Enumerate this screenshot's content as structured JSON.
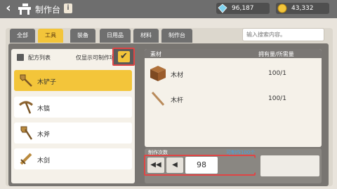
{
  "header": {
    "title": "制作台",
    "info_label": "i",
    "diamonds": "96,187",
    "coins": "43,332",
    "back_label": "‹"
  },
  "tabs": [
    {
      "label": "全部",
      "active": false
    },
    {
      "label": "工具",
      "active": true
    },
    {
      "label": "装备",
      "active": false
    },
    {
      "label": "日用品",
      "active": false
    },
    {
      "label": "材料",
      "active": false
    },
    {
      "label": "制作台",
      "active": false
    }
  ],
  "search": {
    "placeholder": "输入搜索内容。"
  },
  "recipe_list": {
    "title": "配方列表",
    "filter_label": "仅显示可制作项",
    "filter_checked": true,
    "items": [
      {
        "name": "木铲子",
        "selected": true,
        "icon": "wood-shovel-icon"
      },
      {
        "name": "木镐",
        "selected": false,
        "icon": "wood-pickaxe-icon"
      },
      {
        "name": "木斧",
        "selected": false,
        "icon": "wood-axe-icon"
      },
      {
        "name": "木剑",
        "selected": false,
        "icon": "wood-sword-icon"
      }
    ]
  },
  "materials": {
    "col_material": "素材",
    "col_owned": "拥有量/所需量",
    "rows": [
      {
        "name": "木材",
        "qty": "100/1",
        "icon": "wood-block-icon"
      },
      {
        "name": "木杆",
        "qty": "100/1",
        "icon": "wood-stick-icon"
      }
    ]
  },
  "craft": {
    "label": "制作次数",
    "max_text": "可制作100个",
    "count": "98",
    "first_label": "◀◀",
    "prev_label": "◀"
  },
  "colors": {
    "accent": "#f3c53a",
    "highlight_border": "#e04545",
    "link": "#4aa0e0"
  }
}
